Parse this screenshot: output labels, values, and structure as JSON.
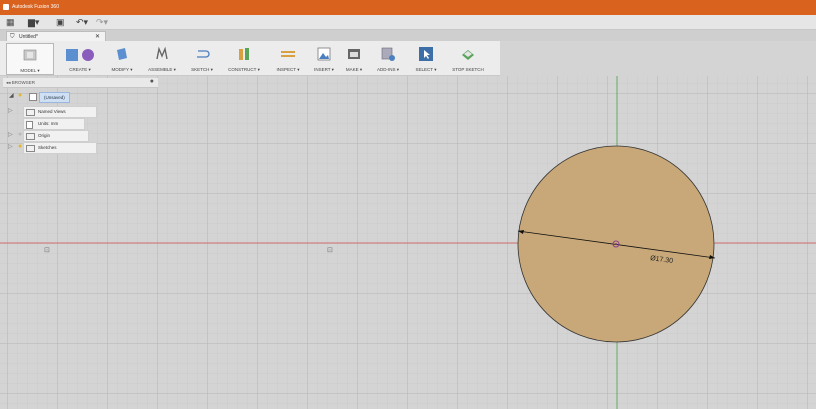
{
  "app": {
    "title": "Autodesk Fusion 360",
    "brand_color": "#d8621e"
  },
  "document": {
    "tab_name": "Untitled*"
  },
  "toolbar": {
    "workspace": "MODEL ▾",
    "groups": [
      "CREATE ▾",
      "MODIFY ▾",
      "ASSEMBLE ▾",
      "SKETCH ▾",
      "CONSTRUCT ▾",
      "INSPECT ▾",
      "INSERT ▾",
      "MAKE ▾",
      "ADD-INS ▾",
      "SELECT ▾",
      "STOP SKETCH"
    ]
  },
  "browser": {
    "header": "◂◂  BROWSER",
    "root": "(Unsaved)",
    "items": [
      "Named Views",
      "Units: mm",
      "Origin",
      "Sketches"
    ]
  },
  "canvas": {
    "dimension": "Ø17.30",
    "circle_fill": "#c8a878",
    "axis_red": "#d05050",
    "axis_green": "#3c9b3c"
  }
}
